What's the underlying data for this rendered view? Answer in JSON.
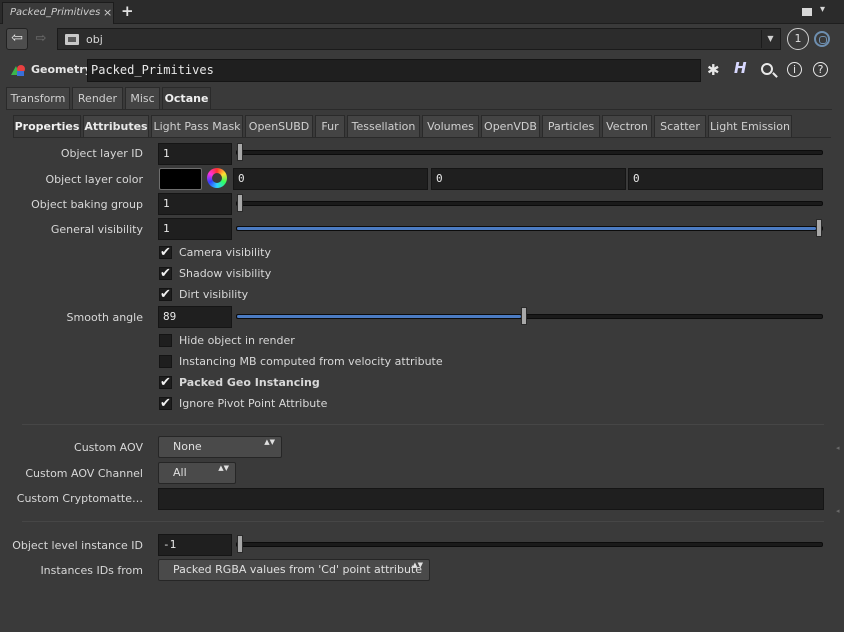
{
  "window": {
    "tab_label": "Packed_Primitives",
    "tab_close": "×",
    "add_tab": "+",
    "chevron": "▾"
  },
  "pathbar": {
    "back": "⇦",
    "forward": "⇨",
    "path": "obj",
    "dropdown": "▼",
    "pane_number": "1"
  },
  "node": {
    "type_label": "Geometry",
    "name": "Packed_Primitives",
    "gear": "✱",
    "help": "H",
    "info": "i",
    "question": "?"
  },
  "main_tabs": [
    {
      "label": "Transform"
    },
    {
      "label": "Render"
    },
    {
      "label": "Misc"
    },
    {
      "label": "Octane"
    }
  ],
  "sub_tabs": [
    {
      "label": "Properties"
    },
    {
      "label": "Attributes"
    },
    {
      "label": "Light Pass Mask"
    },
    {
      "label": "OpenSUBD"
    },
    {
      "label": "Fur"
    },
    {
      "label": "Tessellation"
    },
    {
      "label": "Volumes"
    },
    {
      "label": "OpenVDB"
    },
    {
      "label": "Particles"
    },
    {
      "label": "Vectron"
    },
    {
      "label": "Scatter"
    },
    {
      "label": "Light Emission"
    }
  ],
  "params": {
    "object_layer_id": {
      "label": "Object layer ID",
      "value": "1",
      "slider_fraction": 0.0
    },
    "object_layer_color": {
      "label": "Object layer color",
      "r": "0",
      "g": "0",
      "b": "0",
      "swatch_color": "#000000"
    },
    "object_baking_group": {
      "label": "Object baking group",
      "value": "1",
      "slider_fraction": 0.0
    },
    "general_visibility": {
      "label": "General visibility",
      "value": "1",
      "slider_fraction": 1.0
    },
    "camera_visibility": {
      "label": "Camera visibility",
      "checked": true
    },
    "shadow_visibility": {
      "label": "Shadow visibility",
      "checked": true
    },
    "dirt_visibility": {
      "label": "Dirt visibility",
      "checked": true
    },
    "smooth_angle": {
      "label": "Smooth angle",
      "value": "89",
      "slider_fraction": 0.49
    },
    "hide_object": {
      "label": "Hide object in render",
      "checked": false
    },
    "instancing_mb": {
      "label": "Instancing MB computed from velocity attribute",
      "checked": false
    },
    "packed_geo_instancing": {
      "label": "Packed Geo Instancing",
      "checked": true
    },
    "ignore_pivot": {
      "label": "Ignore Pivot Point Attribute",
      "checked": true
    },
    "custom_aov": {
      "label": "Custom AOV",
      "value": "None"
    },
    "custom_aov_channel": {
      "label": "Custom AOV Channel",
      "value": "All"
    },
    "custom_cryptomatte": {
      "label": "Custom Cryptomatte…",
      "value": ""
    },
    "object_level_instance_id": {
      "label": "Object level instance ID",
      "value": "-1",
      "slider_fraction": 0.0
    },
    "instances_ids_from": {
      "label": "Instances IDs from",
      "value": "Packed RGBA values from 'Cd' point attribute"
    }
  },
  "colors": {
    "accent": "#4b7bc2",
    "panel": "#3a3a3a",
    "field": "#1f1f1f"
  },
  "check_glyph": "✔",
  "select_arrows": "▲▼"
}
